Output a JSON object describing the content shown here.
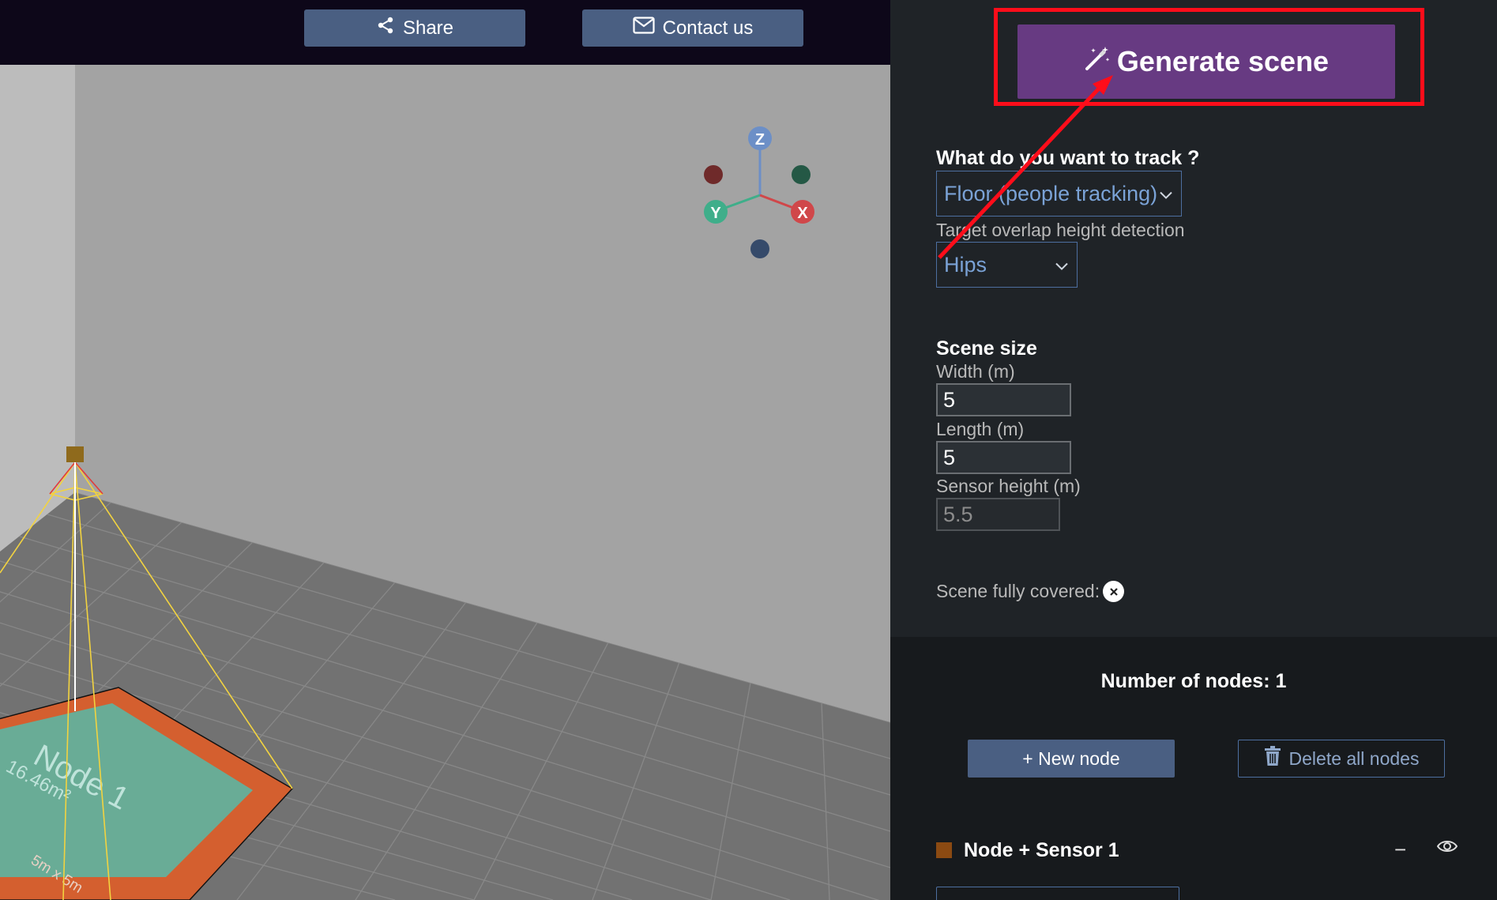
{
  "header": {
    "share_label": "Share",
    "contact_label": "Contact us"
  },
  "viewport": {
    "gizmo": {
      "z_label": "Z",
      "y_label": "Y",
      "x_label": "X"
    },
    "node_label": "Node 1",
    "area_label": "16.46m²",
    "size_label": "5m x 5m"
  },
  "panel": {
    "generate_label": "Generate scene",
    "track_question": "What do you want to track ?",
    "track_value": "Floor (people tracking)",
    "overlap_label": "Target overlap height detection",
    "overlap_value": "Hips",
    "scene_size_title": "Scene size",
    "width_label": "Width (m)",
    "width_value": "5",
    "length_label": "Length (m)",
    "length_value": "5",
    "sensor_height_label": "Sensor height (m)",
    "sensor_height_value": "5.5",
    "covered_label": "Scene fully covered:",
    "node_count_label": "Number of nodes: 1",
    "new_node_label": "+ New node",
    "delete_all_label": "Delete all nodes",
    "node_title": "Node + Sensor 1",
    "collapse_symbol": "−"
  },
  "colors": {
    "accent_purple": "#673a82",
    "button_blue": "#4a5f82",
    "highlight_red": "#ff0d1a",
    "node_swatch": "#8b4a12"
  },
  "icons": [
    "share-icon",
    "mail-icon",
    "magic-wand-icon",
    "chevron-down-icon",
    "close-icon",
    "trash-icon",
    "eye-icon"
  ]
}
